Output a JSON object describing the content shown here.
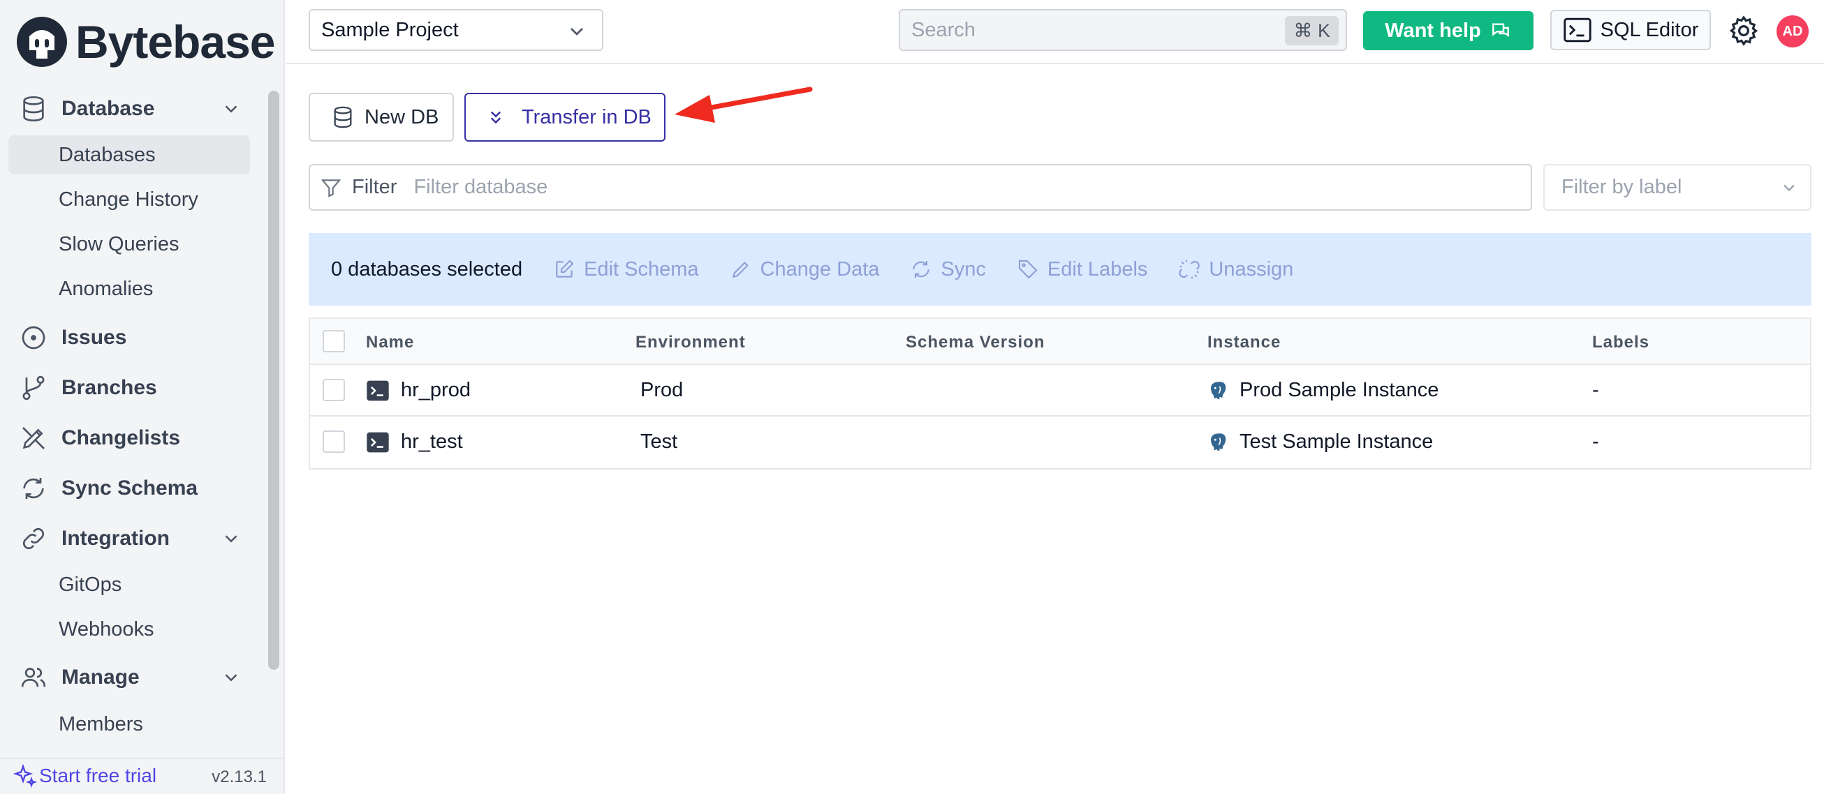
{
  "brand": {
    "name": "Bytebase"
  },
  "sidebar": {
    "sections": [
      {
        "label": "Database",
        "icon": "database-icon",
        "expandable": true
      },
      {
        "label": "Issues",
        "icon": "issues-icon"
      },
      {
        "label": "Branches",
        "icon": "branch-icon"
      },
      {
        "label": "Changelists",
        "icon": "changelist-icon"
      },
      {
        "label": "Sync Schema",
        "icon": "sync-icon"
      },
      {
        "label": "Integration",
        "icon": "link-icon",
        "expandable": true
      },
      {
        "label": "Manage",
        "icon": "users-icon",
        "expandable": true
      }
    ],
    "database_items": [
      "Databases",
      "Change History",
      "Slow Queries",
      "Anomalies"
    ],
    "integration_items": [
      "GitOps",
      "Webhooks"
    ],
    "manage_items": [
      "Members"
    ],
    "active_item": "Databases",
    "trial_label": "Start free trial",
    "version": "v2.13.1"
  },
  "header": {
    "project": "Sample Project",
    "search_placeholder": "Search",
    "shortcut": "⌘ K",
    "help_label": "Want help",
    "sql_editor_label": "SQL Editor",
    "avatar_initials": "AD"
  },
  "toolbar": {
    "new_db_label": "New DB",
    "transfer_label": "Transfer in DB"
  },
  "filter": {
    "label": "Filter",
    "placeholder": "Filter database",
    "label_filter_placeholder": "Filter by label"
  },
  "batch": {
    "selected_text": "0 databases selected",
    "actions": [
      "Edit Schema",
      "Change Data",
      "Sync",
      "Edit Labels",
      "Unassign"
    ]
  },
  "table": {
    "columns": [
      "Name",
      "Environment",
      "Schema Version",
      "Instance",
      "Labels"
    ],
    "rows": [
      {
        "name": "hr_prod",
        "environment": "Prod",
        "schema_version": "",
        "instance": "Prod Sample Instance",
        "labels": "-"
      },
      {
        "name": "hr_test",
        "environment": "Test",
        "schema_version": "",
        "instance": "Test Sample Instance",
        "labels": "-"
      }
    ]
  },
  "colors": {
    "accent": "#4f46e5",
    "help_button": "#10b981",
    "batch_bar": "#dbeafe",
    "annotation_arrow": "#ef2a1f",
    "avatar": "#f43f5e"
  }
}
